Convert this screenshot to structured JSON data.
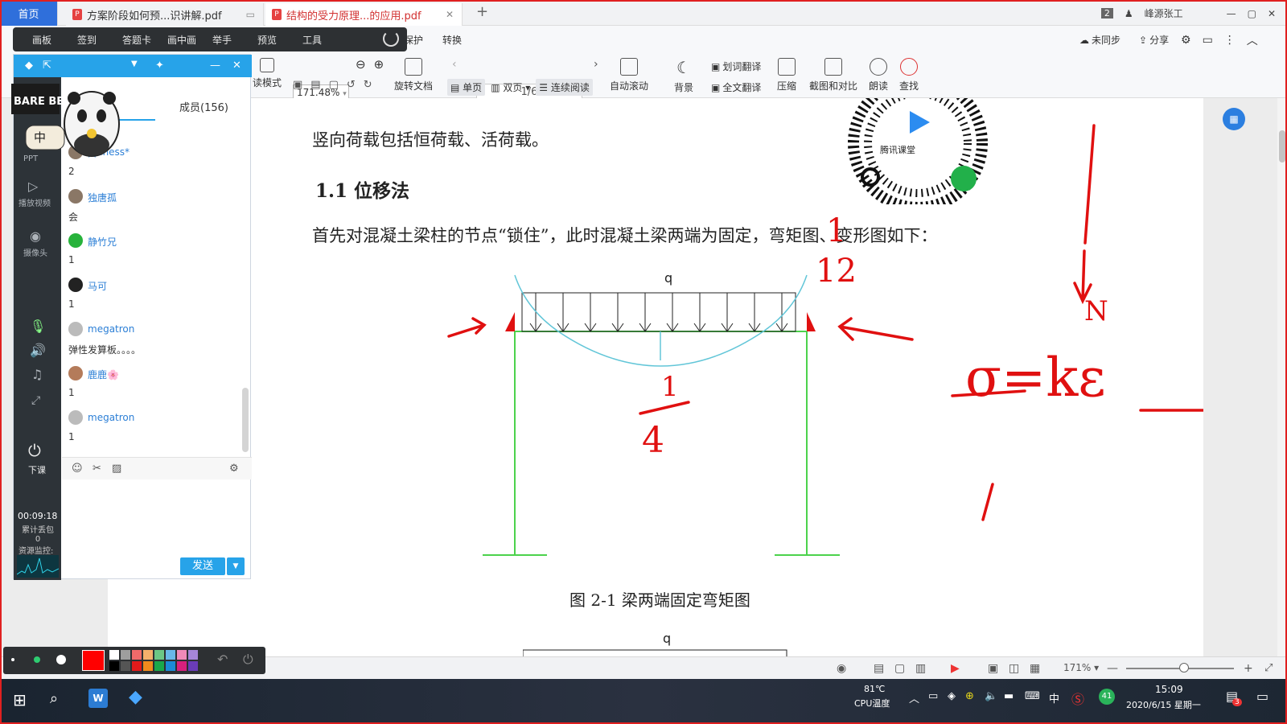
{
  "tabs": {
    "home": "首页",
    "tab1": "方案阶段如何预...识讲解.pdf",
    "tab2": "结构的受力原理...的应用.pdf",
    "new_tab": "+",
    "badge_count": "2",
    "user": "峰源张工"
  },
  "wb_toolbar": [
    "画板",
    "签到",
    "答题卡",
    "画中画",
    "举手",
    "预览",
    "工具"
  ],
  "ribbon": {
    "protect": "保护",
    "convert": "转换",
    "sync": "未同步",
    "share": "分享",
    "mode": "读模式",
    "zoom": "171.48%",
    "page": "1/6",
    "rotate": "旋转文档",
    "single": "单页",
    "double": "双页",
    "continuous": "连续阅读",
    "autoscroll": "自动滚动",
    "background": "背景",
    "word_translate": "划词翻译",
    "full_translate": "全文翻译",
    "compress": "压缩",
    "screenshot": "截图和对比",
    "read_aloud": "朗读",
    "find": "查找"
  },
  "doc": {
    "para1": "竖向荷载包括恒荷载、活荷载。",
    "heading": "1.1 位移法",
    "para2": "首先对混凝土梁柱的节点“锁住”，此时混凝土梁两端为固定，弯矩图、变形图如下：",
    "q_label": "q",
    "q_label2": "q",
    "caption": "图 2-1  梁两端固定弯矩图",
    "qr_label": "腾讯课堂"
  },
  "annotations": {
    "frac_top_num": "1",
    "frac_top_den": "12",
    "frac_bot_num": "1",
    "frac_bot_den": "4",
    "n_label": "N",
    "formula": "σ=kε"
  },
  "chat": {
    "members_tab": "成员(156)",
    "messages": [
      {
        "name": "ppiness*",
        "text": "2"
      },
      {
        "name": "独唐孤",
        "text": "会"
      },
      {
        "name": "静竹兄",
        "text": "1"
      },
      {
        "name": "马可",
        "text": "1"
      },
      {
        "name": "megatron",
        "text": "弹性发算板。。。。"
      },
      {
        "name": "鹿鹿🌸",
        "text": "1"
      },
      {
        "name": "megatron",
        "text": "1"
      }
    ],
    "send": "发送",
    "timer": "00:09:18",
    "packet_label": "累计丢包",
    "packet_value": "0",
    "resource_label": "资源监控:",
    "end_class": "下课",
    "side_items": [
      "PPT",
      "播放视频",
      "摄像头"
    ],
    "bear_text": "中",
    "bear_brand": "BARE BEARS"
  },
  "status": {
    "zoom": "171%"
  },
  "taskbar": {
    "temp": "81℃",
    "temp_label": "CPU温度",
    "time": "15:09",
    "date": "2020/6/15 星期一",
    "ime": "中",
    "notif": "3",
    "count41": "41"
  }
}
